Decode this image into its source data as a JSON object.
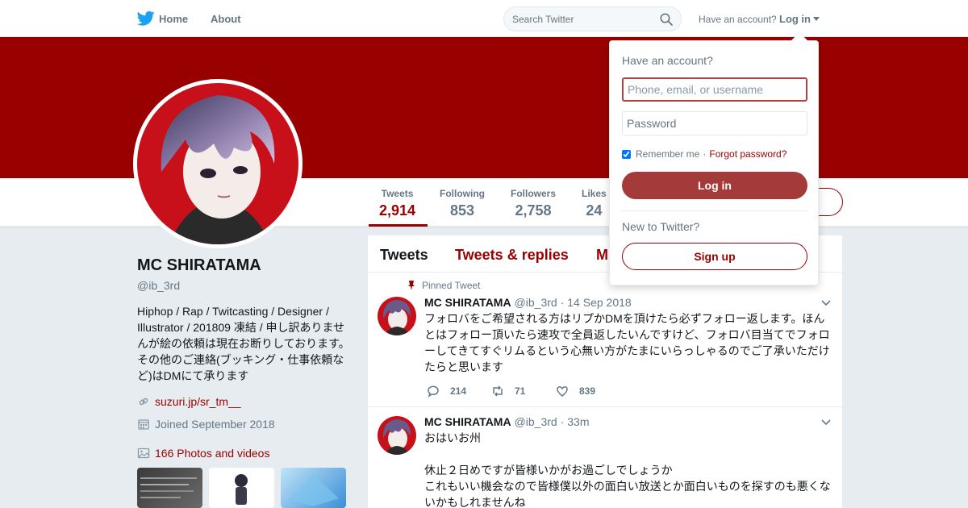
{
  "nav": {
    "home": "Home",
    "about": "About",
    "search_placeholder": "Search Twitter",
    "have_account": "Have an account?",
    "login": "Log in"
  },
  "profile": {
    "name": "MC SHIRATAMA",
    "handle": "@ib_3rd",
    "bio": "Hiphop / Rap / Twitcasting / Designer / Illustrator / 201809 凍結 / 申し訳ありませんが絵の依頼は現在お断りしております。その他のご連絡(ブッキング・仕事依頼など)はDMにて承ります",
    "link": "suzuri.jp/sr_tm__",
    "joined": "Joined September 2018",
    "photos": "166 Photos and videos"
  },
  "stats": [
    {
      "label": "Tweets",
      "value": "2,914"
    },
    {
      "label": "Following",
      "value": "853"
    },
    {
      "label": "Followers",
      "value": "2,758"
    },
    {
      "label": "Likes",
      "value": "24"
    }
  ],
  "timeline_tabs": [
    "Tweets",
    "Tweets & replies",
    "M"
  ],
  "tweets": [
    {
      "pinned_label": "Pinned Tweet",
      "name": "MC SHIRATAMA",
      "handle": "@ib_3rd",
      "date": "· 14 Sep 2018",
      "text": "フォロバをご希望される方はリプかDMを頂けたら必ずフォロー返します。ほんとはフォロー頂いたら速攻で全員返したいんですけど、フォロバ目当てでフォローしてきてすぐリムるという心無い方がたまにいらっしゃるのでご了承いただけたらと思います",
      "replies": "214",
      "retweets": "71",
      "likes": "839"
    },
    {
      "name": "MC SHIRATAMA",
      "handle": "@ib_3rd",
      "date": "· 33m",
      "line1": "おはいお州",
      "line2": "休止２日めですが皆様いかがお過ごしでしょうか",
      "line3": "これもいい機会なので皆様僕以外の面白い放送とか面白いものを探すのも悪くないかもしれませんね"
    }
  ],
  "login_dropdown": {
    "title": "Have an account?",
    "username_placeholder": "Phone, email, or username",
    "password_placeholder": "Password",
    "remember": "Remember me",
    "separator": "·",
    "forgot": "Forgot password?",
    "login_button": "Log in",
    "new_to": "New to Twitter?",
    "signup_button": "Sign up"
  },
  "colors": {
    "theme": "#990000",
    "login_button": "#a53a3a",
    "twitter_blue": "#1da1f2"
  }
}
